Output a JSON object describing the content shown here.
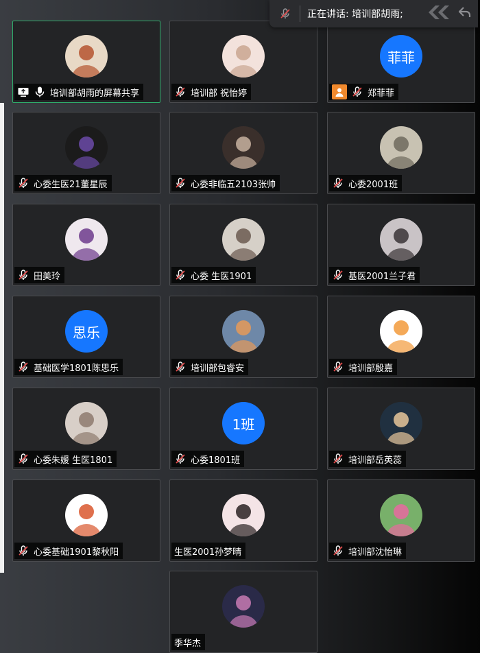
{
  "speaking_indicator": {
    "label": "正在讲话: 培训部胡雨;"
  },
  "participants": [
    {
      "name": "培训部胡雨的屏幕共享",
      "avatar_type": "photo",
      "icons": [
        "screen-share-icon",
        "mic-on-icon"
      ],
      "active": true
    },
    {
      "name": "培训部 祝怡婷",
      "avatar_type": "photo",
      "icons": [
        "mic-muted-icon"
      ]
    },
    {
      "name": "郑菲菲",
      "avatar_type": "text",
      "avatar_text": "菲菲",
      "icons": [
        "person-icon",
        "mic-muted-icon"
      ]
    },
    {
      "name": "心委生医21董星辰",
      "avatar_type": "photo",
      "icons": [
        "mic-muted-icon"
      ]
    },
    {
      "name": "心委非临五2103张帅",
      "avatar_type": "photo",
      "icons": [
        "mic-muted-icon"
      ]
    },
    {
      "name": "心委2001班",
      "avatar_type": "photo",
      "icons": [
        "mic-muted-icon"
      ]
    },
    {
      "name": "田美玲",
      "avatar_type": "photo",
      "icons": [
        "mic-muted-icon"
      ]
    },
    {
      "name": "心委 生医1901",
      "avatar_type": "photo",
      "icons": [
        "mic-muted-icon"
      ]
    },
    {
      "name": "基医2001兰子君",
      "avatar_type": "photo",
      "icons": [
        "mic-muted-icon"
      ]
    },
    {
      "name": "基础医学1801陈思乐",
      "avatar_type": "text",
      "avatar_text": "思乐",
      "icons": [
        "mic-muted-icon"
      ]
    },
    {
      "name": "培训部包睿安",
      "avatar_type": "photo",
      "icons": [
        "mic-muted-icon"
      ]
    },
    {
      "name": "培训部殷嘉",
      "avatar_type": "photo",
      "icons": [
        "mic-muted-icon"
      ]
    },
    {
      "name": "心委朱媛 生医1801",
      "avatar_type": "photo",
      "icons": [
        "mic-muted-icon"
      ]
    },
    {
      "name": "心委1801班",
      "avatar_type": "text",
      "avatar_text": "1班",
      "icons": [
        "mic-muted-icon"
      ]
    },
    {
      "name": "培训部岳英蕊",
      "avatar_type": "photo",
      "icons": [
        "mic-muted-icon"
      ]
    },
    {
      "name": "心委基础1901黎秋阳",
      "avatar_type": "photo",
      "icons": [
        "mic-muted-icon"
      ]
    },
    {
      "name": "生医2001孙梦晴",
      "avatar_type": "photo",
      "icons": []
    },
    {
      "name": "培训部沈怡琳",
      "avatar_type": "photo",
      "icons": [
        "mic-muted-icon"
      ]
    },
    {
      "name": "季华杰",
      "avatar_type": "photo",
      "icons": []
    }
  ],
  "colors": {
    "text_avatar_bg": "#1677ff",
    "active_border": "#2fae6b",
    "tile_bg": "#232426",
    "muted_icon_red": "#e34b4b",
    "person_badge": "#f0892d"
  }
}
